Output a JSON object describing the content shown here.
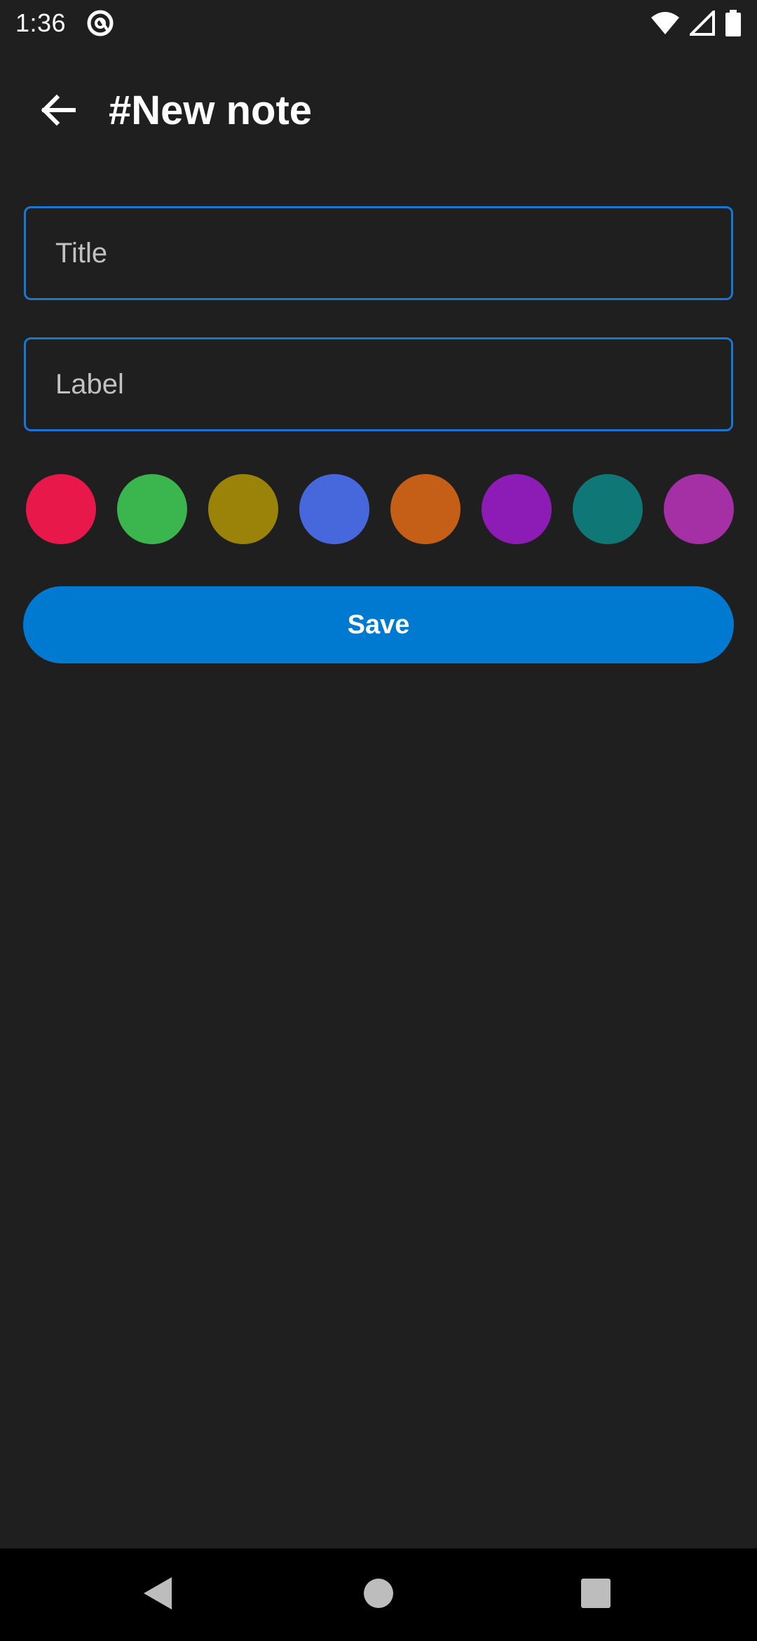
{
  "status_bar": {
    "time": "1:36",
    "icons": [
      "at-sign-icon",
      "wifi-icon",
      "cell-signal-icon",
      "battery-icon"
    ]
  },
  "app_bar": {
    "back_icon": "arrow-left-icon",
    "title": "#New note"
  },
  "form": {
    "title_placeholder": "Title",
    "title_value": "",
    "label_placeholder": "Label",
    "label_value": "",
    "field_border_color": "#1976d2"
  },
  "color_options": [
    {
      "name": "red",
      "hex": "#e8194a"
    },
    {
      "name": "green",
      "hex": "#3bb54e"
    },
    {
      "name": "olive",
      "hex": "#9a8308"
    },
    {
      "name": "blue",
      "hex": "#4668dc"
    },
    {
      "name": "orange",
      "hex": "#c55f17"
    },
    {
      "name": "purple",
      "hex": "#8d1cb7"
    },
    {
      "name": "teal",
      "hex": "#0f7775"
    },
    {
      "name": "magenta",
      "hex": "#a52fa4"
    }
  ],
  "save_button": {
    "label": "Save",
    "color": "#0079d0"
  },
  "nav_bar": {
    "icons": [
      "back-triangle-icon",
      "home-circle-icon",
      "recents-square-icon"
    ]
  }
}
